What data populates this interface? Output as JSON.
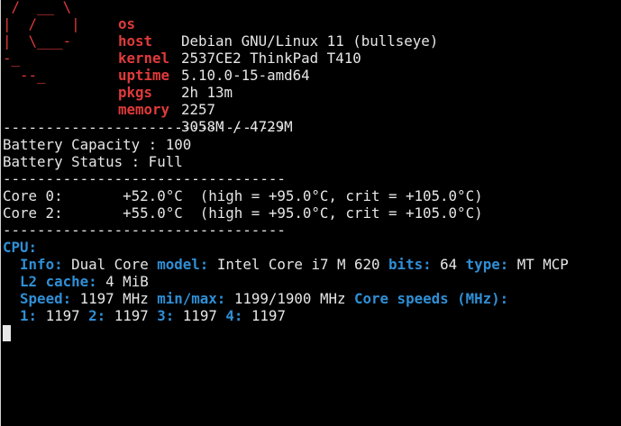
{
  "logo": {
    "lines": [
      " /  __ \\",
      "|  /    |",
      "|  \\___-",
      "-_",
      "  --_"
    ],
    "color": "#e03a3a"
  },
  "sysinfo": [
    {
      "key": "os",
      "value": "Debian GNU/Linux 11 (bullseye)"
    },
    {
      "key": "host",
      "value": "2537CE2 ThinkPad T410"
    },
    {
      "key": "kernel",
      "value": "5.10.0-15-amd64"
    },
    {
      "key": "uptime",
      "value": "2h 13m"
    },
    {
      "key": "pkgs",
      "value": "2257"
    },
    {
      "key": "memory",
      "value": "3058M / 4729M"
    }
  ],
  "separator": "---------------------------------",
  "battery": {
    "capacity": "Battery Capacity : 100",
    "status": "Battery Status : Full"
  },
  "sensors": {
    "core0": "Core 0:       +52.0°C  (high = +95.0°C, crit = +105.0°C)",
    "core2": "Core 2:       +55.0°C  (high = +95.0°C, crit = +105.0°C)"
  },
  "cpu": {
    "header": "CPU:",
    "info_label": "Info:",
    "info_value": "Dual Core",
    "model_label": "model:",
    "model_value": "Intel Core i7 M 620",
    "bits_label": "bits:",
    "bits_value": "64",
    "type_label": "type:",
    "type_value": "MT MCP",
    "l2_label": "L2 cache:",
    "l2_value": "4 MiB",
    "speed_label": "Speed:",
    "speed_value": "1197 MHz",
    "minmax_label": "min/max:",
    "minmax_value": "1199/1900 MHz",
    "core_speeds_label": "Core speeds (MHz):",
    "c1_label": "1:",
    "c1_value": "1197",
    "c2_label": "2:",
    "c2_value": "1197",
    "c3_label": "3:",
    "c3_value": "1197",
    "c4_label": "4:",
    "c4_value": "1197"
  },
  "colors": {
    "background": "#000000",
    "text": "#e6e6e6",
    "accent_red": "#e03a3a",
    "accent_blue": "#2f8fd6"
  }
}
